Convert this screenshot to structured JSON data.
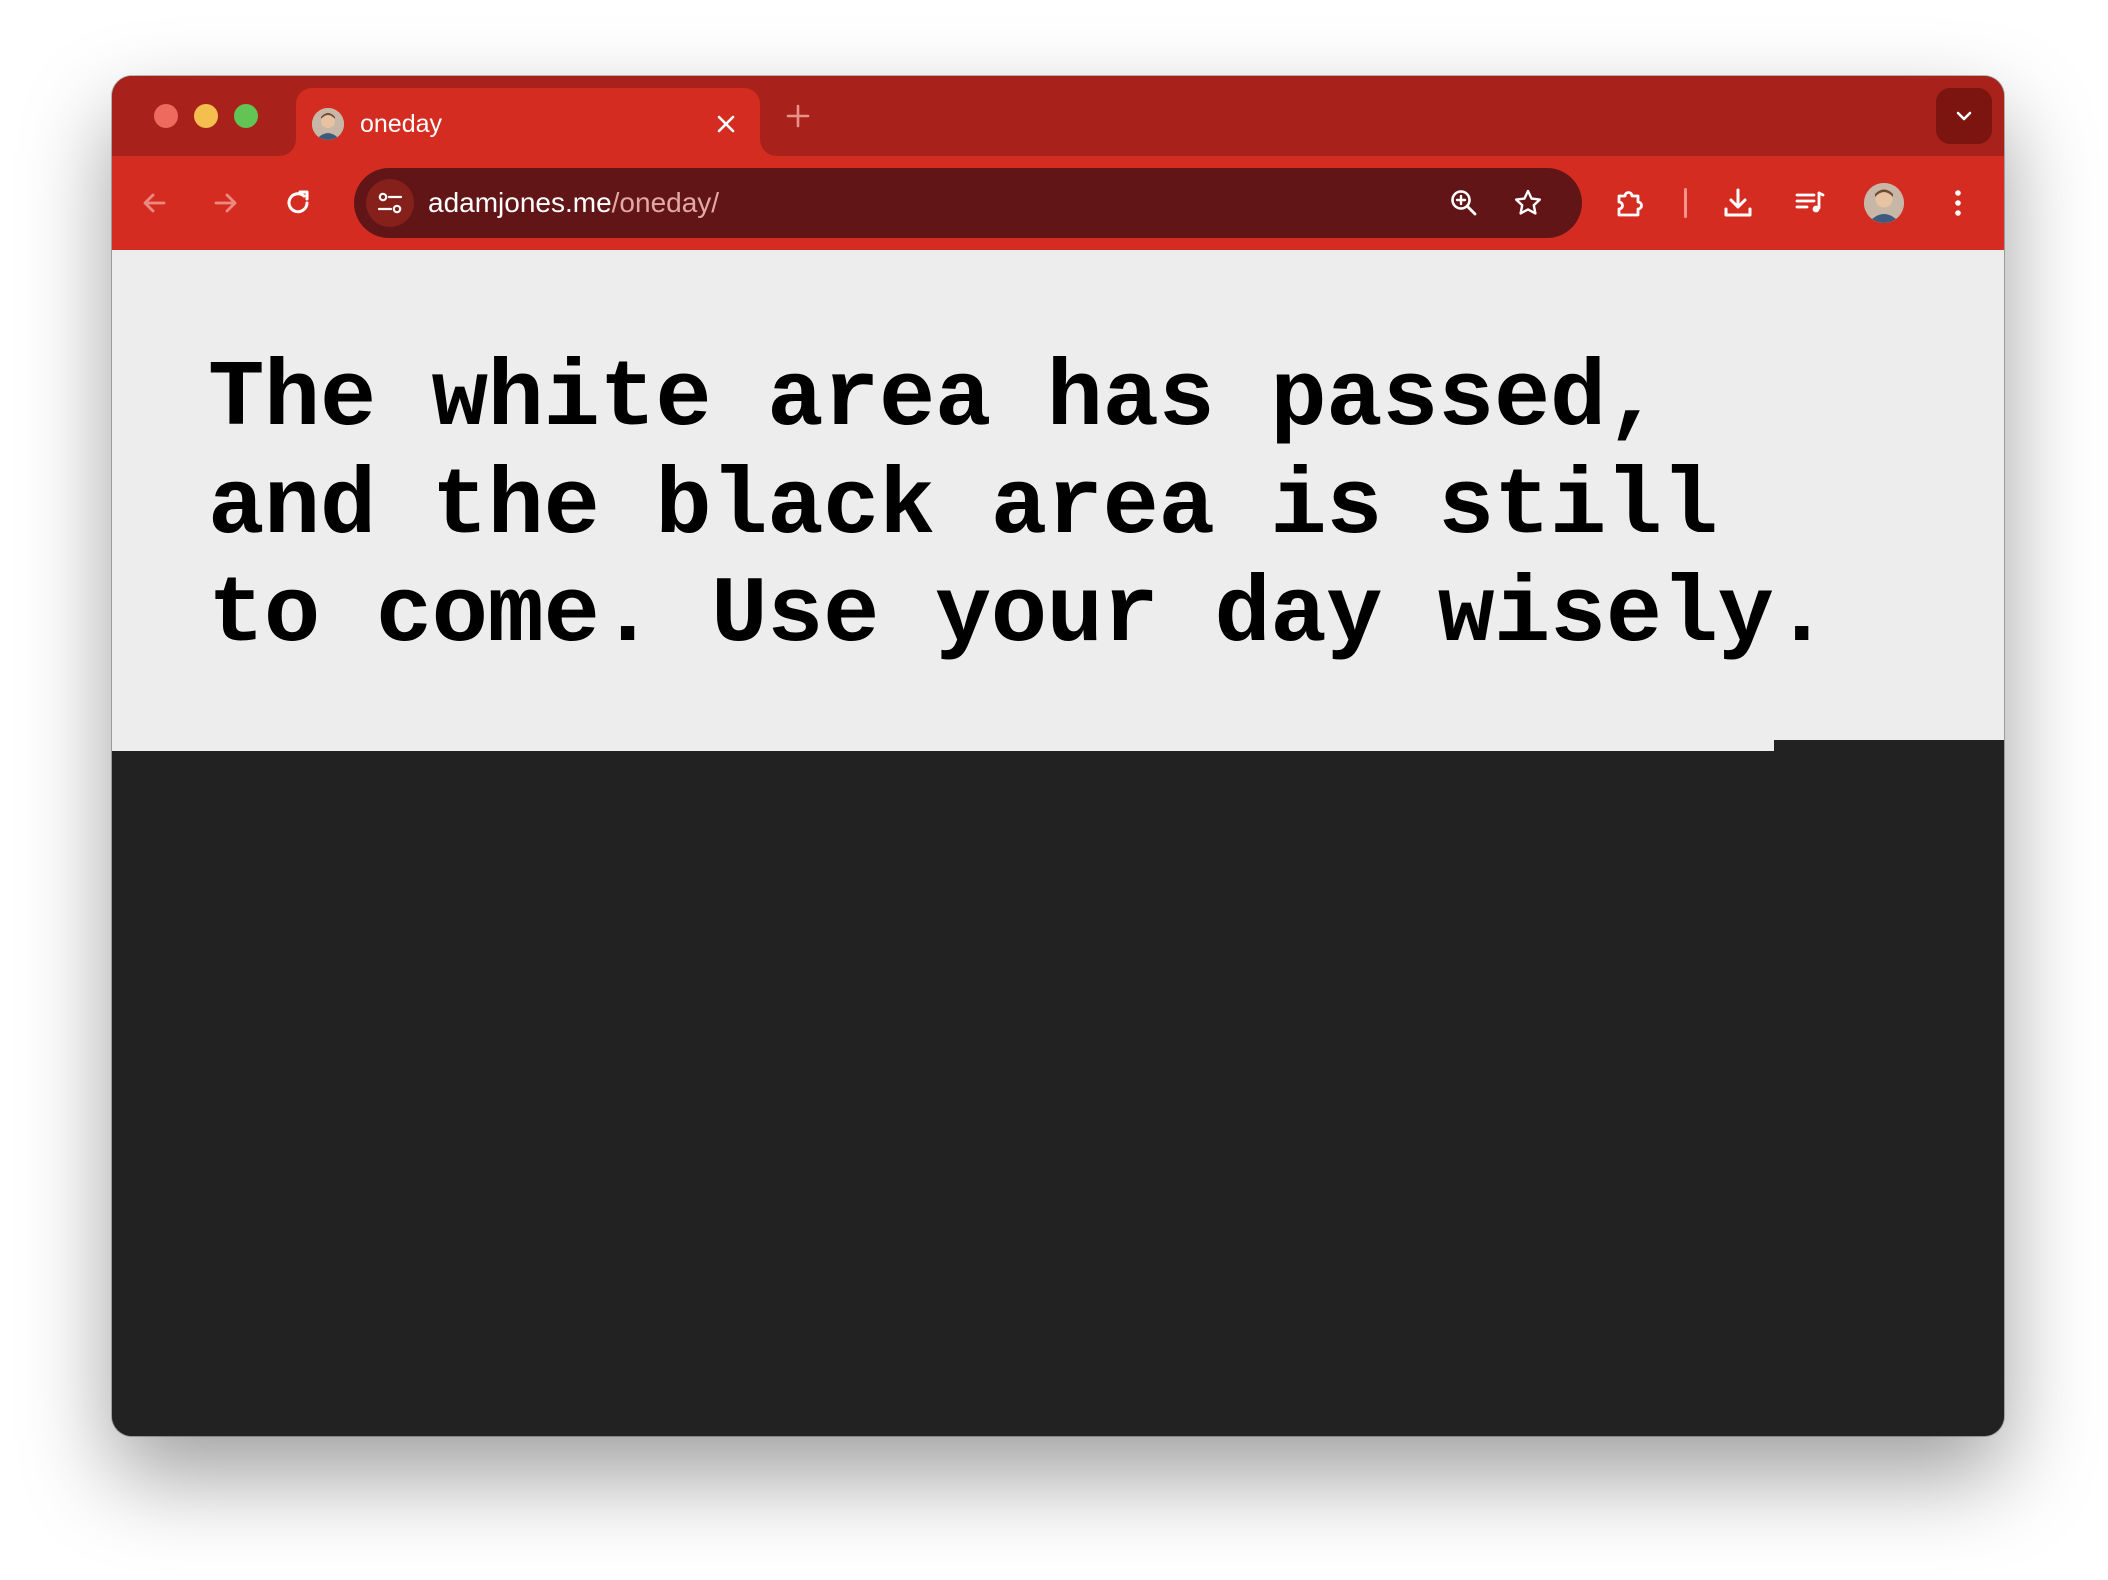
{
  "tab": {
    "title": "oneday",
    "favicon": "profile-photo-favicon"
  },
  "address_bar": {
    "domain": "adamjones.me",
    "path": "/oneday/"
  },
  "page": {
    "message": "The white area has passed,\nand the black area is still\nto come. Use your day wisely.",
    "colors": {
      "passed_area": "#ededed",
      "remaining_area": "#222222",
      "text": "#000000"
    }
  },
  "theme": {
    "tabstrip": "#a8221b",
    "toolbar": "#d52c22",
    "omnibox": "#621516"
  },
  "icons": {
    "back": "arrow-left-icon",
    "forward": "arrow-right-icon",
    "reload": "reload-icon",
    "site_info": "tune-icon",
    "zoom": "zoom-in-icon",
    "bookmark": "star-icon",
    "extensions": "puzzle-icon",
    "downloads": "download-icon",
    "media": "media-queue-icon",
    "menu": "kebab-menu-icon",
    "tab_search": "chevron-down-icon",
    "new_tab": "plus-icon",
    "close_tab": "close-icon"
  }
}
